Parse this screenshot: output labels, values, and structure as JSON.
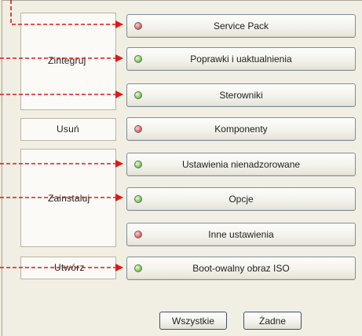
{
  "groups": {
    "zintegruj": "Zintegruj",
    "usun": "Usuń",
    "zainstaluj": "Zainstaluj",
    "utworz": "Utwórz"
  },
  "buttons": [
    {
      "label": "Service Pack",
      "status": "red"
    },
    {
      "label": "Poprawki i uaktualnienia",
      "status": "green"
    },
    {
      "label": "Sterowniki",
      "status": "green"
    },
    {
      "label": "Komponenty",
      "status": "red"
    },
    {
      "label": "Ustawienia nienadzorowane",
      "status": "green"
    },
    {
      "label": "Opcje",
      "status": "green"
    },
    {
      "label": "Inne ustawienia",
      "status": "red"
    },
    {
      "label": "Boot-owalny obraz ISO",
      "status": "green"
    }
  ],
  "footer": {
    "all_label": "Wszystkie",
    "none_label": "Żadne"
  },
  "colors": {
    "arrow": "#e01818",
    "status_red": "#e06868",
    "status_green": "#7bcf55"
  }
}
